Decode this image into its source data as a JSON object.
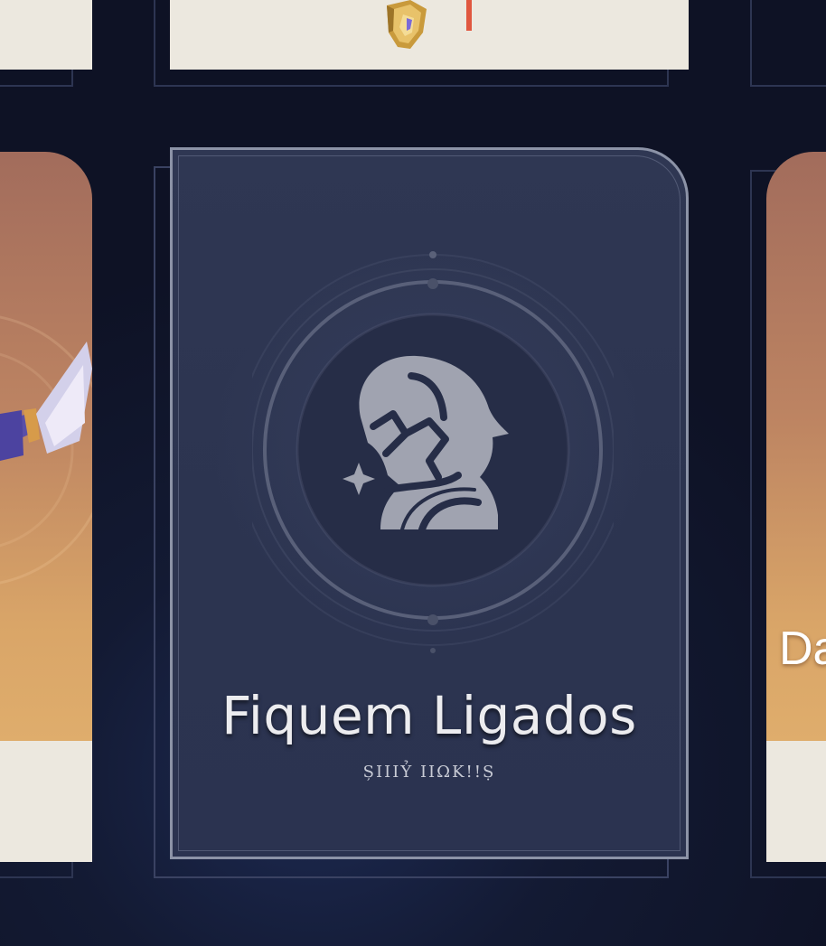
{
  "top_row": {
    "center_card": {
      "icon": "golden-weapon-icon",
      "marker_color": "#e0573f"
    }
  },
  "middle_row": {
    "focused_card": {
      "title": "Fiquem Ligados",
      "subtitle": "ȘIIIỶ IIΩK!!Ṣ",
      "icon": "character-silhouette-icon",
      "frame_color": "#8c93a7",
      "background_color": "#2f3753"
    },
    "left_card": {
      "art": "character-splash-art",
      "strip_color": "#ece8df"
    },
    "right_card": {
      "name_partial": "Da",
      "art": "character-splash-art"
    }
  },
  "colors": {
    "background": "#0e1225",
    "warm_card": "#d9a568",
    "frame_line": "#2d3552"
  }
}
